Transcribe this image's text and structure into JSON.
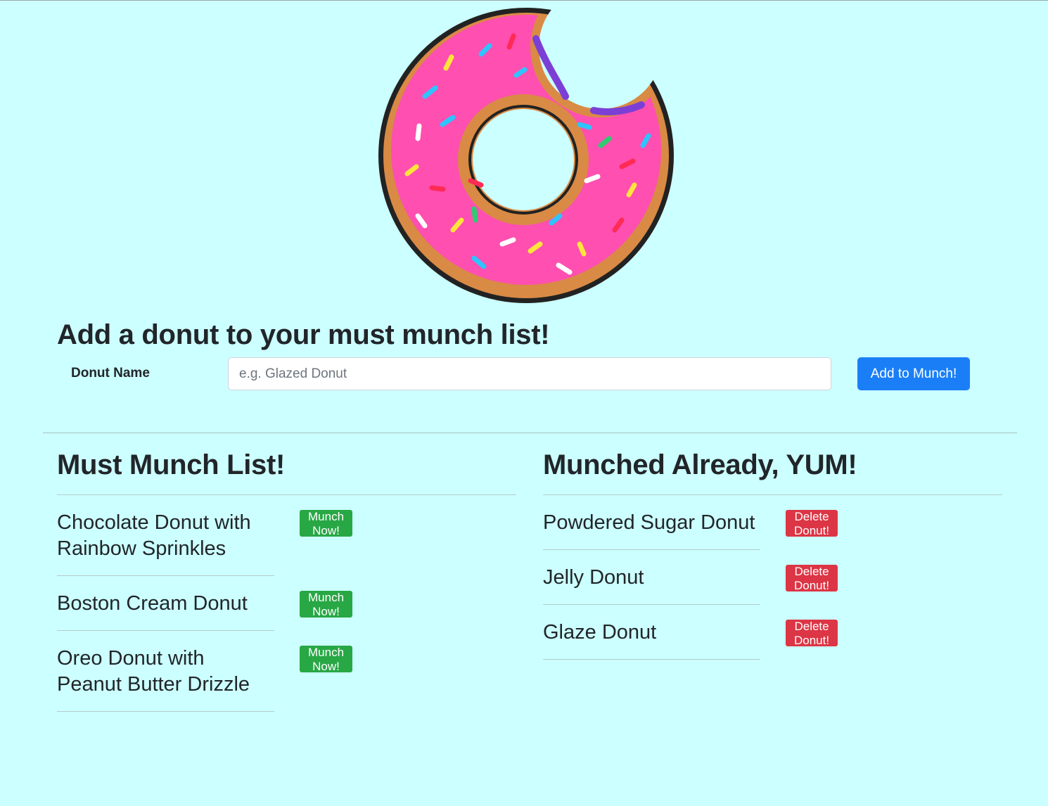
{
  "page": {
    "background": "#ccffff"
  },
  "logo": {
    "icon": "bitten-donut-icon",
    "frosting_color": "#ff4fb0",
    "dough_color": "#d98a44"
  },
  "add_form": {
    "title": "Add a donut to your must munch list!",
    "label": "Donut Name",
    "placeholder": "e.g. Glazed Donut",
    "value": "",
    "button": "Add to Munch!",
    "button_color": "#1a7ff7"
  },
  "must_munch": {
    "title": "Must Munch List!",
    "button_label": "Munch Now!",
    "button_color": "#28a745",
    "items": [
      {
        "name": "Chocolate Donut with Rainbow Sprinkles",
        "button": "Munch Now!"
      },
      {
        "name": "Boston Cream Donut",
        "button": "Munch Now!"
      },
      {
        "name": "Oreo Donut with Peanut Butter Drizzle",
        "button": "Munch Now!"
      }
    ]
  },
  "munched": {
    "title": "Munched Already, YUM!",
    "button_label": "Delete Donut!",
    "button_color": "#dc3545",
    "items": [
      {
        "name": "Powdered Sugar Donut",
        "button": "Delete Donut!"
      },
      {
        "name": "Jelly Donut",
        "button": "Delete Donut!"
      },
      {
        "name": "Glaze Donut",
        "button": "Delete Donut!"
      }
    ]
  }
}
